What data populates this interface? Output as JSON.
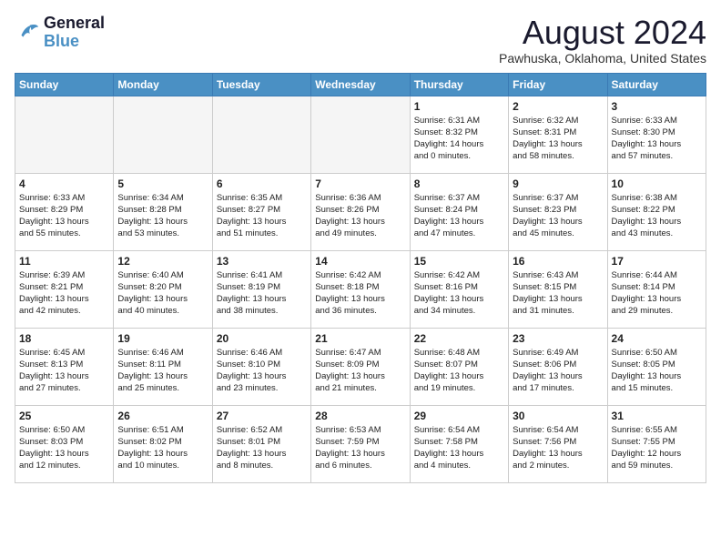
{
  "header": {
    "logo": {
      "line1": "General",
      "line2": "Blue"
    },
    "title": "August 2024",
    "subtitle": "Pawhuska, Oklahoma, United States"
  },
  "weekdays": [
    "Sunday",
    "Monday",
    "Tuesday",
    "Wednesday",
    "Thursday",
    "Friday",
    "Saturday"
  ],
  "weeks": [
    [
      {
        "day": "",
        "info": ""
      },
      {
        "day": "",
        "info": ""
      },
      {
        "day": "",
        "info": ""
      },
      {
        "day": "",
        "info": ""
      },
      {
        "day": "1",
        "info": "Sunrise: 6:31 AM\nSunset: 8:32 PM\nDaylight: 14 hours\nand 0 minutes."
      },
      {
        "day": "2",
        "info": "Sunrise: 6:32 AM\nSunset: 8:31 PM\nDaylight: 13 hours\nand 58 minutes."
      },
      {
        "day": "3",
        "info": "Sunrise: 6:33 AM\nSunset: 8:30 PM\nDaylight: 13 hours\nand 57 minutes."
      }
    ],
    [
      {
        "day": "4",
        "info": "Sunrise: 6:33 AM\nSunset: 8:29 PM\nDaylight: 13 hours\nand 55 minutes."
      },
      {
        "day": "5",
        "info": "Sunrise: 6:34 AM\nSunset: 8:28 PM\nDaylight: 13 hours\nand 53 minutes."
      },
      {
        "day": "6",
        "info": "Sunrise: 6:35 AM\nSunset: 8:27 PM\nDaylight: 13 hours\nand 51 minutes."
      },
      {
        "day": "7",
        "info": "Sunrise: 6:36 AM\nSunset: 8:26 PM\nDaylight: 13 hours\nand 49 minutes."
      },
      {
        "day": "8",
        "info": "Sunrise: 6:37 AM\nSunset: 8:24 PM\nDaylight: 13 hours\nand 47 minutes."
      },
      {
        "day": "9",
        "info": "Sunrise: 6:37 AM\nSunset: 8:23 PM\nDaylight: 13 hours\nand 45 minutes."
      },
      {
        "day": "10",
        "info": "Sunrise: 6:38 AM\nSunset: 8:22 PM\nDaylight: 13 hours\nand 43 minutes."
      }
    ],
    [
      {
        "day": "11",
        "info": "Sunrise: 6:39 AM\nSunset: 8:21 PM\nDaylight: 13 hours\nand 42 minutes."
      },
      {
        "day": "12",
        "info": "Sunrise: 6:40 AM\nSunset: 8:20 PM\nDaylight: 13 hours\nand 40 minutes."
      },
      {
        "day": "13",
        "info": "Sunrise: 6:41 AM\nSunset: 8:19 PM\nDaylight: 13 hours\nand 38 minutes."
      },
      {
        "day": "14",
        "info": "Sunrise: 6:42 AM\nSunset: 8:18 PM\nDaylight: 13 hours\nand 36 minutes."
      },
      {
        "day": "15",
        "info": "Sunrise: 6:42 AM\nSunset: 8:16 PM\nDaylight: 13 hours\nand 34 minutes."
      },
      {
        "day": "16",
        "info": "Sunrise: 6:43 AM\nSunset: 8:15 PM\nDaylight: 13 hours\nand 31 minutes."
      },
      {
        "day": "17",
        "info": "Sunrise: 6:44 AM\nSunset: 8:14 PM\nDaylight: 13 hours\nand 29 minutes."
      }
    ],
    [
      {
        "day": "18",
        "info": "Sunrise: 6:45 AM\nSunset: 8:13 PM\nDaylight: 13 hours\nand 27 minutes."
      },
      {
        "day": "19",
        "info": "Sunrise: 6:46 AM\nSunset: 8:11 PM\nDaylight: 13 hours\nand 25 minutes."
      },
      {
        "day": "20",
        "info": "Sunrise: 6:46 AM\nSunset: 8:10 PM\nDaylight: 13 hours\nand 23 minutes."
      },
      {
        "day": "21",
        "info": "Sunrise: 6:47 AM\nSunset: 8:09 PM\nDaylight: 13 hours\nand 21 minutes."
      },
      {
        "day": "22",
        "info": "Sunrise: 6:48 AM\nSunset: 8:07 PM\nDaylight: 13 hours\nand 19 minutes."
      },
      {
        "day": "23",
        "info": "Sunrise: 6:49 AM\nSunset: 8:06 PM\nDaylight: 13 hours\nand 17 minutes."
      },
      {
        "day": "24",
        "info": "Sunrise: 6:50 AM\nSunset: 8:05 PM\nDaylight: 13 hours\nand 15 minutes."
      }
    ],
    [
      {
        "day": "25",
        "info": "Sunrise: 6:50 AM\nSunset: 8:03 PM\nDaylight: 13 hours\nand 12 minutes."
      },
      {
        "day": "26",
        "info": "Sunrise: 6:51 AM\nSunset: 8:02 PM\nDaylight: 13 hours\nand 10 minutes."
      },
      {
        "day": "27",
        "info": "Sunrise: 6:52 AM\nSunset: 8:01 PM\nDaylight: 13 hours\nand 8 minutes."
      },
      {
        "day": "28",
        "info": "Sunrise: 6:53 AM\nSunset: 7:59 PM\nDaylight: 13 hours\nand 6 minutes."
      },
      {
        "day": "29",
        "info": "Sunrise: 6:54 AM\nSunset: 7:58 PM\nDaylight: 13 hours\nand 4 minutes."
      },
      {
        "day": "30",
        "info": "Sunrise: 6:54 AM\nSunset: 7:56 PM\nDaylight: 13 hours\nand 2 minutes."
      },
      {
        "day": "31",
        "info": "Sunrise: 6:55 AM\nSunset: 7:55 PM\nDaylight: 12 hours\nand 59 minutes."
      }
    ]
  ],
  "colors": {
    "header_bg": "#4a90c4",
    "header_text": "#ffffff",
    "row_even_bg": "#f0f4f8",
    "row_odd_bg": "#ffffff"
  }
}
